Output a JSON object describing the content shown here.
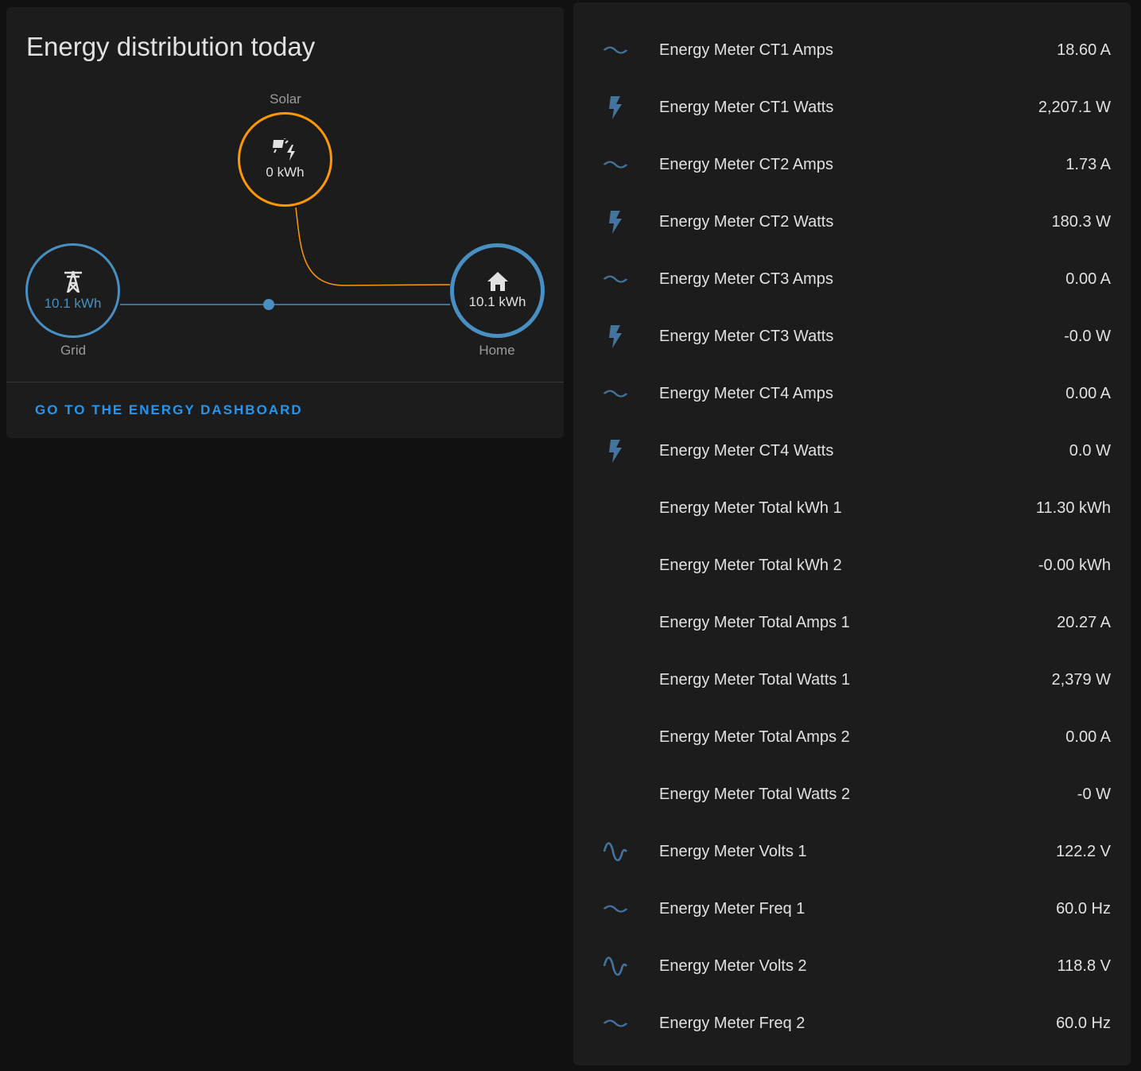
{
  "energy_card": {
    "title": "Energy distribution today",
    "solar": {
      "label": "Solar",
      "value": "0 kWh",
      "icon": "solar-power-icon"
    },
    "grid": {
      "label": "Grid",
      "value": "10.1 kWh",
      "icon": "transmission-tower-icon"
    },
    "home": {
      "label": "Home",
      "value": "10.1 kWh",
      "icon": "home-icon"
    },
    "link_label": "GO TO THE ENERGY DASHBOARD",
    "colors": {
      "solar": "#ff9800",
      "grid": "#488fc2",
      "link": "#2196f3"
    }
  },
  "entities": [
    {
      "name": "Energy Meter CT1 Amps",
      "value": "18.60 A",
      "icon": "current-ac-icon"
    },
    {
      "name": "Energy Meter CT1 Watts",
      "value": "2,207.1 W",
      "icon": "flash-icon"
    },
    {
      "name": "Energy Meter CT2 Amps",
      "value": "1.73 A",
      "icon": "current-ac-icon"
    },
    {
      "name": "Energy Meter CT2 Watts",
      "value": "180.3 W",
      "icon": "flash-icon"
    },
    {
      "name": "Energy Meter CT3 Amps",
      "value": "0.00 A",
      "icon": "current-ac-icon"
    },
    {
      "name": "Energy Meter CT3 Watts",
      "value": "-0.0 W",
      "icon": "flash-icon"
    },
    {
      "name": "Energy Meter CT4 Amps",
      "value": "0.00 A",
      "icon": "current-ac-icon"
    },
    {
      "name": "Energy Meter CT4 Watts",
      "value": "0.0 W",
      "icon": "flash-icon"
    },
    {
      "name": "Energy Meter Total kWh 1",
      "value": "11.30 kWh",
      "icon": ""
    },
    {
      "name": "Energy Meter Total kWh 2",
      "value": "-0.00 kWh",
      "icon": ""
    },
    {
      "name": "Energy Meter Total Amps 1",
      "value": "20.27 A",
      "icon": ""
    },
    {
      "name": "Energy Meter Total Watts 1",
      "value": "2,379 W",
      "icon": ""
    },
    {
      "name": "Energy Meter Total Amps 2",
      "value": "0.00 A",
      "icon": ""
    },
    {
      "name": "Energy Meter Total Watts 2",
      "value": "-0 W",
      "icon": ""
    },
    {
      "name": "Energy Meter Volts 1",
      "value": "122.2 V",
      "icon": "sine-wave-icon"
    },
    {
      "name": "Energy Meter Freq 1",
      "value": "60.0 Hz",
      "icon": "current-ac-icon"
    },
    {
      "name": "Energy Meter Volts 2",
      "value": "118.8 V",
      "icon": "sine-wave-icon"
    },
    {
      "name": "Energy Meter Freq 2",
      "value": "60.0 Hz",
      "icon": "current-ac-icon"
    }
  ],
  "icon_color": "#44739e"
}
